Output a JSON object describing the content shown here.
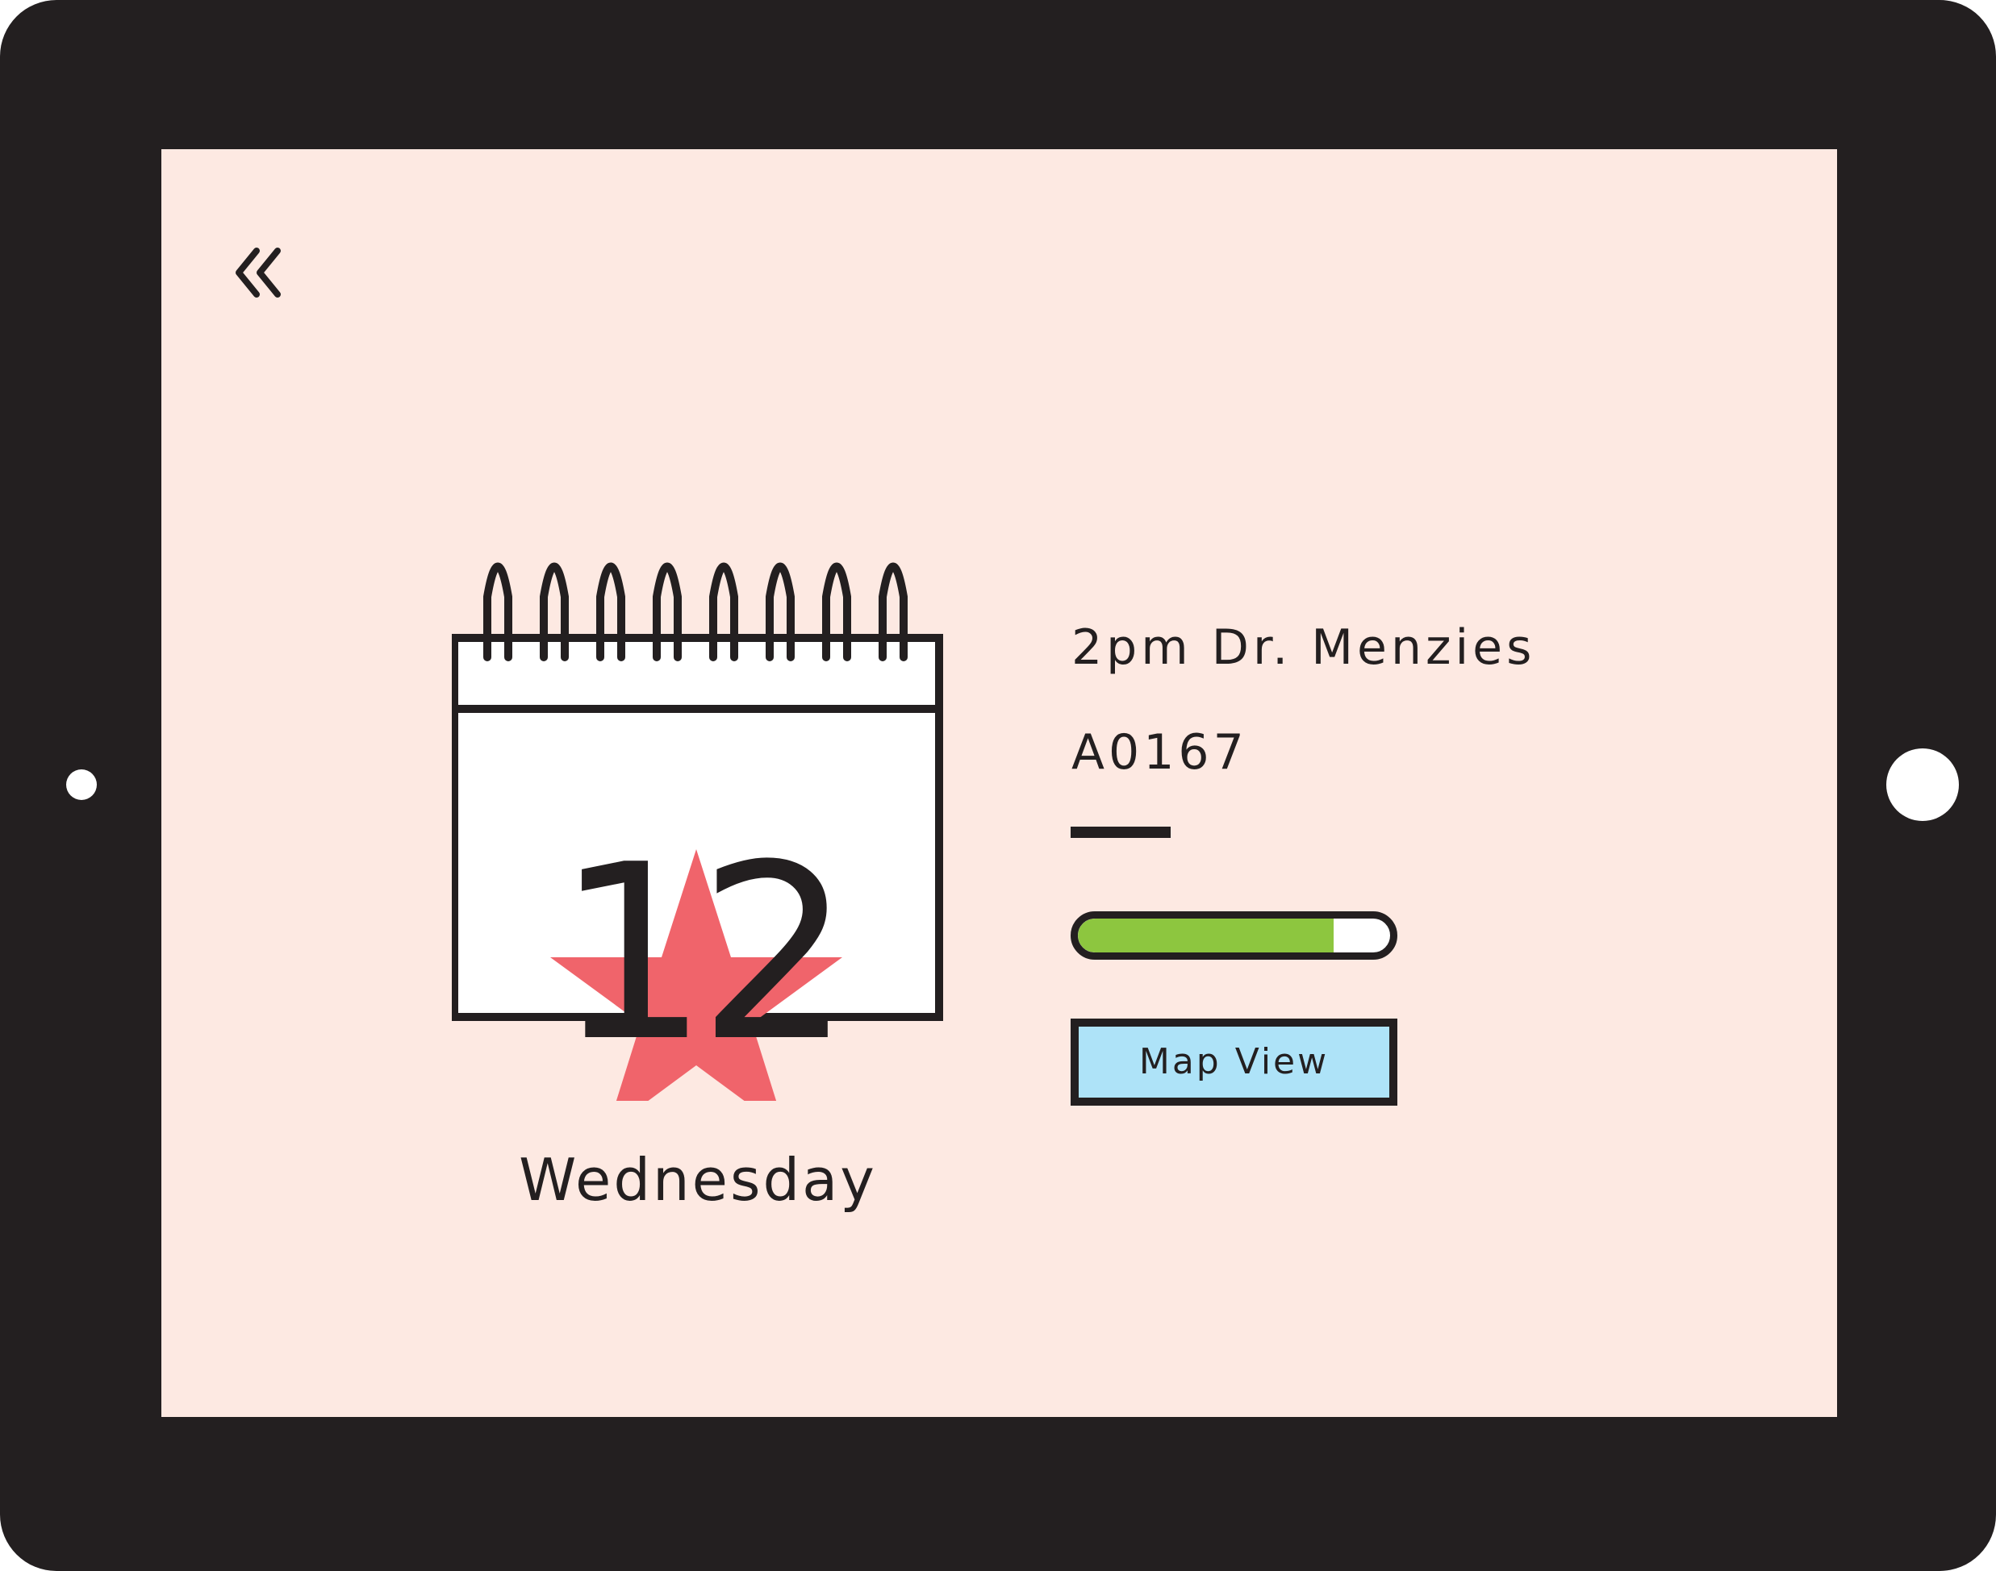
{
  "calendar": {
    "day_number": "12",
    "weekday": "Wednesday",
    "star_color": "#f0646b"
  },
  "appointment": {
    "title": "2pm Dr. Menzies",
    "code": "A0167",
    "progress": 0.82
  },
  "map_button": {
    "label": "Map View"
  },
  "colors": {
    "device": "#231f20",
    "screen_background": "#fde9e2",
    "progress_fill": "#8dc63f",
    "button_background": "#aee3f8"
  },
  "icons": {
    "back": "double-chevron-left-icon",
    "calendar": "calendar-icon",
    "star": "star-icon"
  }
}
